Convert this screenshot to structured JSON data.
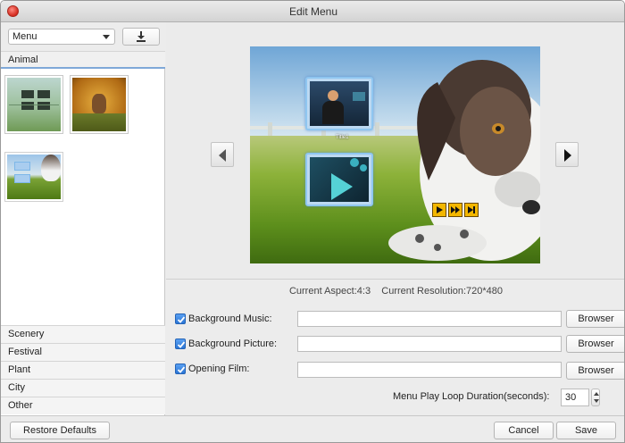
{
  "window": {
    "title": "Edit Menu"
  },
  "sidebar": {
    "template_select": {
      "value": "Menu"
    },
    "active_category": "Animal",
    "categories": [
      "Scenery",
      "Festival",
      "Plant",
      "City",
      "Other"
    ]
  },
  "preview": {
    "menu_item_title": "Title1",
    "info": "Current Aspect:4:3    Current Resolution:720*480"
  },
  "settings": {
    "background_music": {
      "label": "Background Music:",
      "checked": true,
      "value": ""
    },
    "background_picture": {
      "label": "Background Picture:",
      "checked": true,
      "value": ""
    },
    "opening_film": {
      "label": "Opening Film:",
      "checked": true,
      "value": ""
    },
    "browse_label": "Browser",
    "loop_duration_label": "Menu Play Loop Duration(seconds):",
    "loop_duration_value": "30"
  },
  "footer": {
    "restore_label": "Restore Defaults",
    "cancel_label": "Cancel",
    "save_label": "Save"
  },
  "icons": {
    "close": "close-icon",
    "download": "download-icon",
    "dropdown": "chevron-down-icon",
    "prev": "arrow-left-icon",
    "next": "arrow-right-icon",
    "play": "play-icon",
    "fast_forward": "fast-forward-icon",
    "skip_end": "skip-end-icon"
  },
  "colors": {
    "accent": "#2b76d6",
    "selection_border": "#7fa8d8",
    "control_yellow": "#f3b700"
  }
}
